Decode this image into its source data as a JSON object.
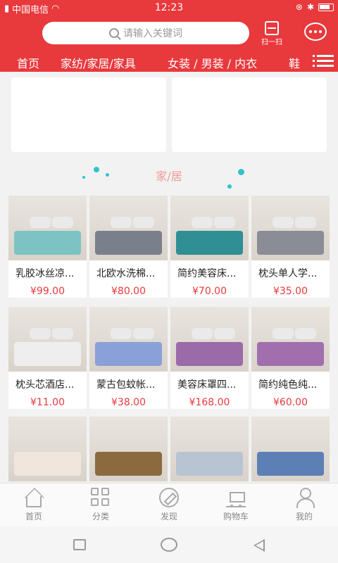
{
  "status": {
    "carrier": "中国电信",
    "time": "12:23"
  },
  "search": {
    "placeholder": "请输入关键词"
  },
  "scan": {
    "label": "扫一扫"
  },
  "nav": [
    "首页",
    "家纺/家居/家具",
    "女装 / 男装 / 内衣",
    "鞋"
  ],
  "section": {
    "title": "家/居"
  },
  "products": [
    {
      "title": "乳胶冰丝凉...",
      "price": "¥99.00",
      "color": "#7ec3c3"
    },
    {
      "title": "北欧水洗棉...",
      "price": "¥80.00",
      "color": "#7a7f8c"
    },
    {
      "title": "简约美容床...",
      "price": "¥70.00",
      "color": "#2f8f94"
    },
    {
      "title": "枕头单人学...",
      "price": "¥35.00",
      "color": "#8a8c96"
    },
    {
      "title": "枕头芯酒店...",
      "price": "¥11.00",
      "color": "#eeeeee"
    },
    {
      "title": "蒙古包蚊帐...",
      "price": "¥38.00",
      "color": "#8aa0d8"
    },
    {
      "title": "美容床罩四...",
      "price": "¥168.00",
      "color": "#9b6aa8"
    },
    {
      "title": "简约纯色纯...",
      "price": "¥60.00",
      "color": "#a16fae"
    },
    {
      "title": "",
      "price": "",
      "color": "#f1e6dc"
    },
    {
      "title": "",
      "price": "",
      "color": "#8c6a40"
    },
    {
      "title": "",
      "price": "",
      "color": "#b9c4d2"
    },
    {
      "title": "",
      "price": "",
      "color": "#5c7fb6"
    }
  ],
  "tabs": [
    {
      "label": "首页",
      "icon": "home-icon"
    },
    {
      "label": "分类",
      "icon": "category-icon"
    },
    {
      "label": "发现",
      "icon": "compass-icon"
    },
    {
      "label": "购物车",
      "icon": "cart-icon"
    },
    {
      "label": "我的",
      "icon": "user-icon"
    }
  ],
  "colors": {
    "brand": "#e8393d",
    "price": "#e8393d",
    "section_title": "#f09a9a",
    "accent_dots": "#30c4c8"
  }
}
